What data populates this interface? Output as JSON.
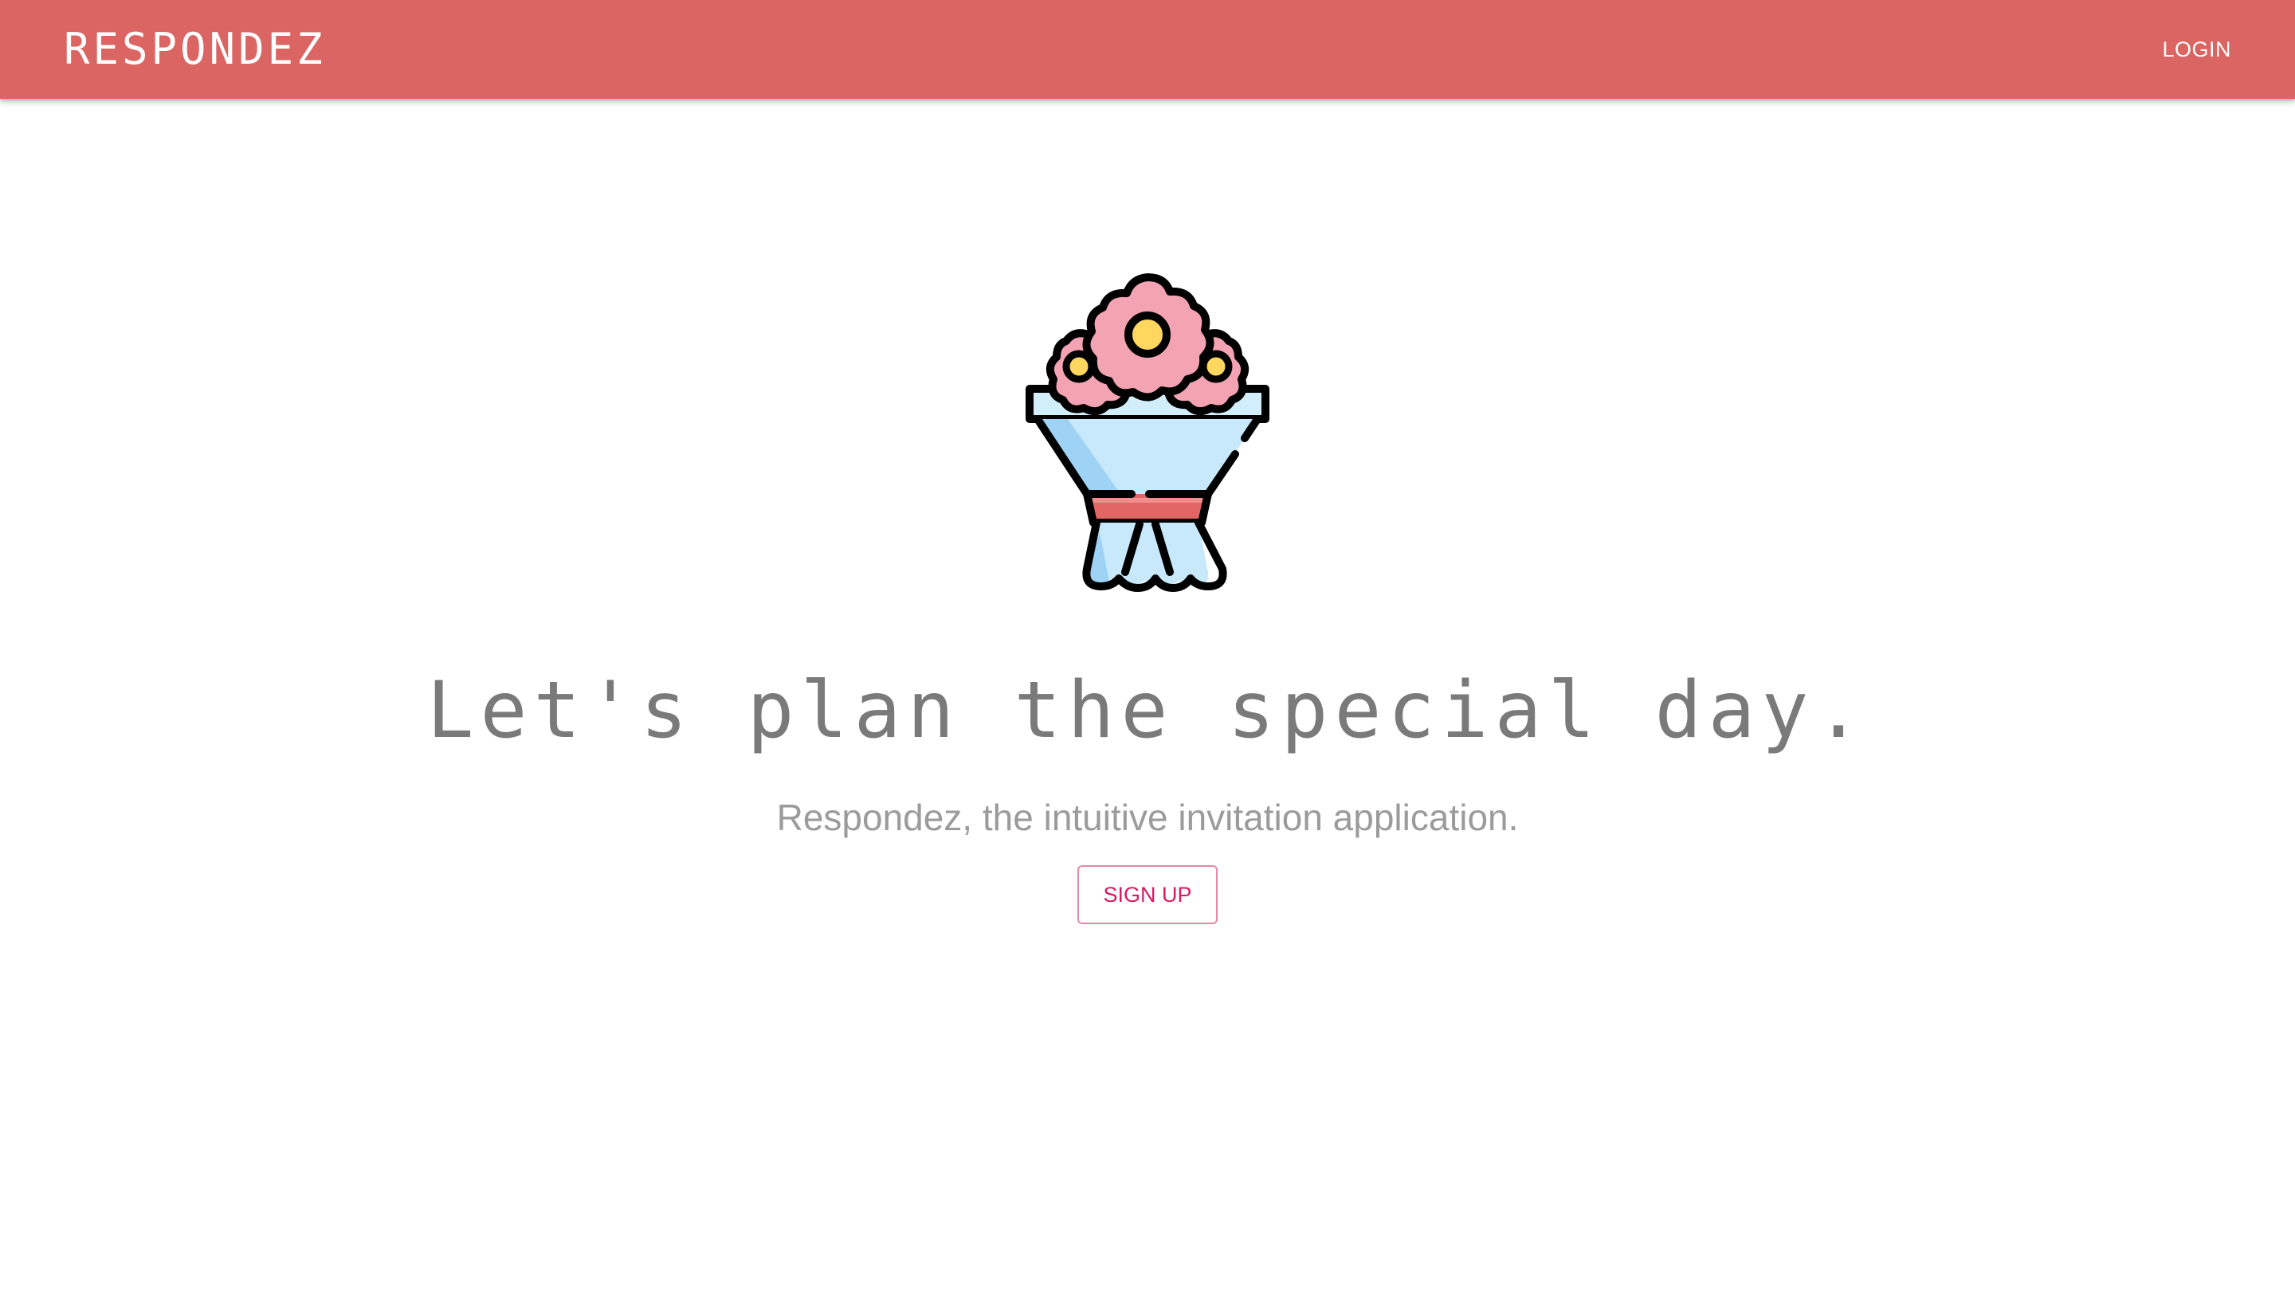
{
  "header": {
    "brand": "RESPONDEZ",
    "login_label": "LOGIN",
    "background_color": "#db6563"
  },
  "hero": {
    "illustration": "flower-bouquet-icon",
    "headline": "Let's plan the special day.",
    "tagline": "Respondez, the intuitive invitation application.",
    "signup_label": "SIGN UP"
  },
  "colors": {
    "accent": "#d81b60",
    "headline_text": "#7a7a7a",
    "tagline_text": "#9b9b9b"
  }
}
